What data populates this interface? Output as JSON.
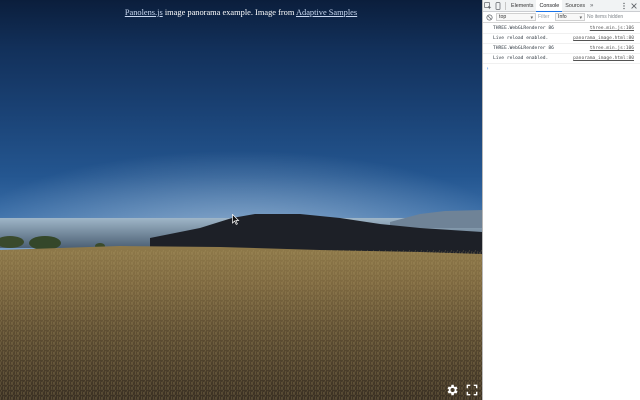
{
  "viewer": {
    "caption": {
      "link1": "Panolens.js",
      "middle": " image panorama example. Image from ",
      "link2": "Adaptive Samples"
    },
    "controls": {
      "settings_icon": "gear-icon",
      "fullscreen_icon": "fullscreen-icon"
    }
  },
  "devtools": {
    "tabs": [
      "Elements",
      "Console",
      "Sources"
    ],
    "active_tab": "Console",
    "more_tabs": "»",
    "toolbar": {
      "context": "top",
      "filter_placeholder": "Filter",
      "level": "Info",
      "hidden_count": "No items hidden"
    },
    "messages": [
      {
        "text": "THREE.WebGLRenderer 86",
        "source": "three.min.js:106"
      },
      {
        "text": "Live reload enabled.",
        "source": "panorama_image.html:80"
      },
      {
        "text": "THREE.WebGLRenderer 86",
        "source": "three.min.js:106"
      },
      {
        "text": "Live reload enabled.",
        "source": "panorama_image.html:80"
      }
    ],
    "prompt": "›"
  },
  "colors": {
    "devtools_accent": "#1a73e8",
    "link": "#c9d8f0"
  }
}
